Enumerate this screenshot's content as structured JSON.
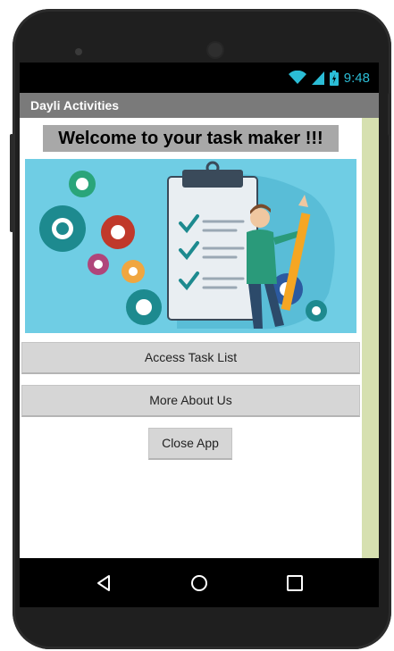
{
  "status_bar": {
    "time": "9:48",
    "icons": [
      "wifi-icon",
      "signal-icon",
      "battery-icon"
    ]
  },
  "app": {
    "title": "Dayli Activities"
  },
  "main": {
    "welcome_text": "Welcome to your task maker !!!",
    "hero_image": "task-checklist-illustration",
    "buttons": {
      "access_task_list": "Access Task List",
      "more_about_us": "More About Us",
      "close_app": "Close App"
    }
  },
  "nav_bar": {
    "items": [
      "back-icon",
      "home-icon",
      "recents-icon"
    ]
  },
  "colors": {
    "title_bar": "#7a7a7a",
    "welcome_bg": "#a8a8a8",
    "button_bg": "#d6d6d6",
    "hero_bg": "#6fcde4",
    "status_accent": "#2bbdd6",
    "side_strip": "#d6e0b0"
  }
}
